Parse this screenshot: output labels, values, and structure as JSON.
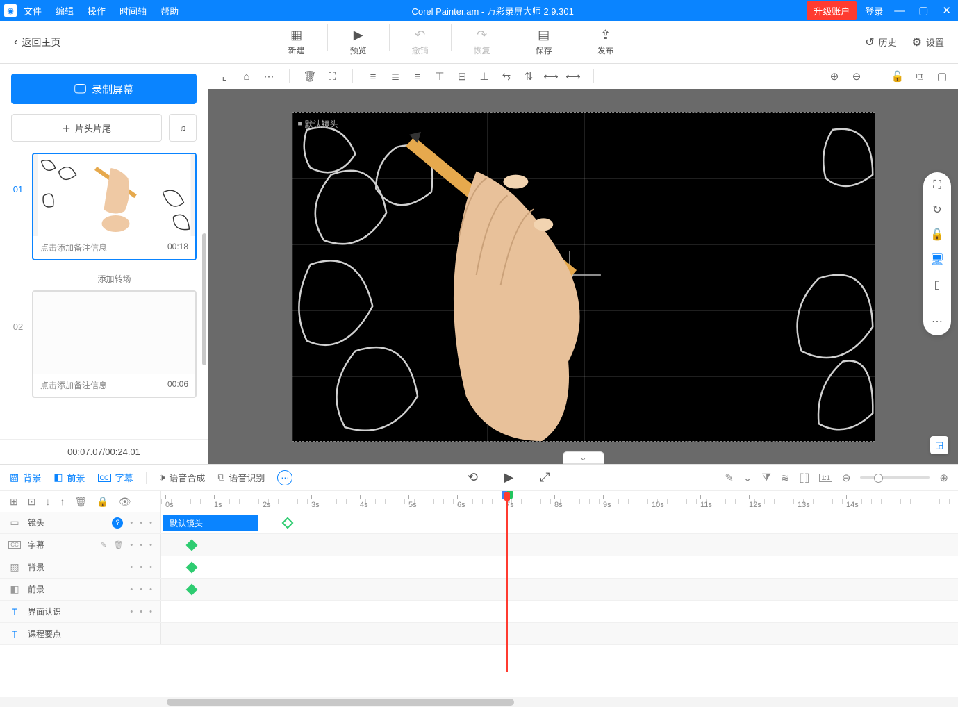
{
  "titlebar": {
    "menus": [
      "文件",
      "编辑",
      "操作",
      "时间轴",
      "帮助"
    ],
    "title": "Corel Painter.am - 万彩录屏大师 2.9.301",
    "upgrade": "升级账户",
    "login": "登录"
  },
  "toolbar": {
    "back": "返回主页",
    "buttons": [
      {
        "icon": "➕",
        "label": "新建"
      },
      {
        "icon": "▶",
        "label": "预览"
      },
      {
        "icon": "↶",
        "label": "撤销",
        "disabled": true
      },
      {
        "icon": "↷",
        "label": "恢复",
        "disabled": true
      },
      {
        "icon": "💾",
        "label": "保存"
      },
      {
        "icon": "⬆",
        "label": "发布"
      }
    ],
    "right": [
      {
        "icon": "↺",
        "label": "历史"
      },
      {
        "icon": "⚙",
        "label": "设置"
      }
    ]
  },
  "sidebar": {
    "record": "录制屏幕",
    "intro": "片头片尾",
    "scenes": [
      {
        "num": "01",
        "note": "点击添加备注信息",
        "dur": "00:18",
        "active": true
      },
      {
        "num": "02",
        "note": "点击添加备注信息",
        "dur": "00:06",
        "active": false
      }
    ],
    "transition": "添加转场",
    "time": "00:07.07/00:24.01"
  },
  "canvas": {
    "camera_label": "默认镜头"
  },
  "bottom_tabs": [
    {
      "icon": "▨",
      "label": "背景",
      "active": true
    },
    {
      "icon": "◧",
      "label": "前景",
      "active": true
    },
    {
      "icon": "CC",
      "label": "字幕",
      "active": true
    },
    {
      "icon": "🕩",
      "label": "语音合成",
      "active": false
    },
    {
      "icon": "⧉",
      "label": "语音识别",
      "active": false
    }
  ],
  "timeline": {
    "marks": [
      "0s",
      "1s",
      "2s",
      "3s",
      "4s",
      "5s",
      "6s",
      "7s",
      "8s",
      "9s",
      "10s",
      "11s",
      "12s",
      "13s",
      "14s"
    ],
    "playhead_sec": 7.07,
    "tracks": [
      {
        "icon": "▭",
        "name": "镜头",
        "help": true,
        "clip": "默认镜头"
      },
      {
        "icon": "CC",
        "name": "字幕",
        "edit": true
      },
      {
        "icon": "▨",
        "name": "背景"
      },
      {
        "icon": "◧",
        "name": "前景"
      },
      {
        "icon": "T",
        "name": "界面认识"
      },
      {
        "icon": "T",
        "name": "课程要点"
      }
    ]
  }
}
